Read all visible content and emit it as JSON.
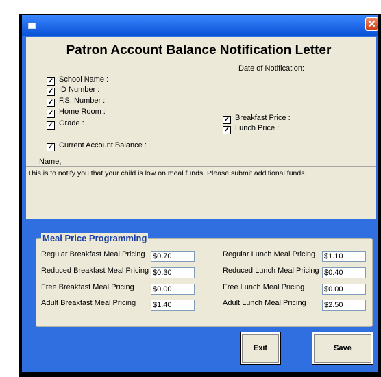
{
  "window": {
    "close_glyph": "✕"
  },
  "letter": {
    "title": "Patron Account Balance Notification Letter",
    "date_label": "Date of Notification:",
    "fields_left": [
      {
        "label": "School Name :",
        "checked": true
      },
      {
        "label": "ID Number :",
        "checked": true
      },
      {
        "label": "F.S. Number :",
        "checked": true
      },
      {
        "label": "Home Room :",
        "checked": true
      },
      {
        "label": "Grade :",
        "checked": true
      }
    ],
    "fields_right": [
      {
        "label": "Breakfast Price :",
        "checked": true
      },
      {
        "label": "Lunch Price :",
        "checked": true
      }
    ],
    "current_balance": {
      "label": "Current Account Balance :",
      "checked": true
    },
    "salutation": "Name,",
    "body": "This is to notify you that your child is low on meal funds. Please submit additional funds"
  },
  "pricing": {
    "title": "Meal Price Programming",
    "breakfast": [
      {
        "label": "Regular Breakfast Meal Pricing",
        "value": "$0.70"
      },
      {
        "label": "Reduced Breakfast Meal Pricing",
        "value": "$0.30"
      },
      {
        "label": "Free Breakfast Meal Pricing",
        "value": "$0.00"
      },
      {
        "label": "Adult Breakfast Meal Pricing",
        "value": "$1.40"
      }
    ],
    "lunch": [
      {
        "label": "Regular Lunch Meal Pricing",
        "value": "$1.10"
      },
      {
        "label": "Reduced Lunch Meal Pricing",
        "value": "$0.40"
      },
      {
        "label": "Free Lunch Meal Pricing",
        "value": "$0.00"
      },
      {
        "label": "Adult Lunch Meal Pricing",
        "value": "$2.50"
      }
    ]
  },
  "buttons": {
    "exit_label": "Exit",
    "save_label": "Save"
  },
  "check_glyph": "✓",
  "colors": {
    "window_blue": "#2f6fe0",
    "panel_bg": "#ece9d8",
    "group_title": "#1a3fa6",
    "close_red": "#cc3c15"
  }
}
